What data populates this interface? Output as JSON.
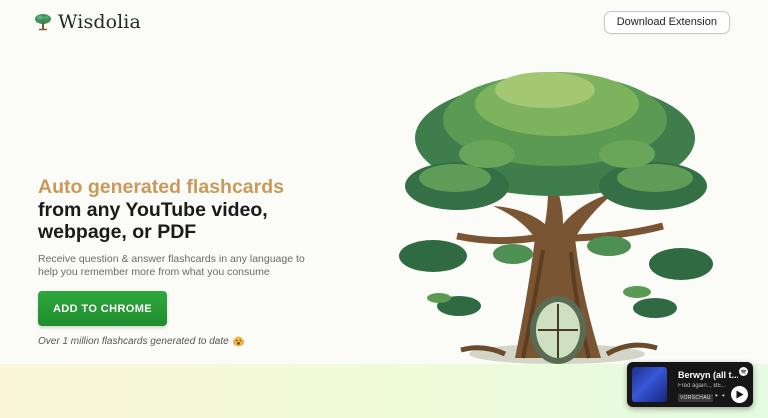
{
  "header": {
    "brand_name": "Wisdolia",
    "download_label": "Download Extension",
    "logo_icon": "tree-logo-icon"
  },
  "hero": {
    "headline_accent": "Auto generated flashcards",
    "headline_line2": "from any YouTube video,",
    "headline_line3": "webpage, or PDF",
    "subtext": "Receive question & answer flashcards in any language to help you remember more from what you consume",
    "cta_label": "ADD TO CHROME",
    "stat_text": "Over 1 million flashcards generated to date",
    "stat_icon": "shocked-face-emoji-icon"
  },
  "player": {
    "title": "Berwyn (all t...",
    "artist": "Fred again.., BE...",
    "badge": "VORSCHAU",
    "more": "• •"
  },
  "colors": {
    "accent": "#c89a5b",
    "cta_green": "#23962f",
    "headline_dark": "#1a1a1a"
  }
}
